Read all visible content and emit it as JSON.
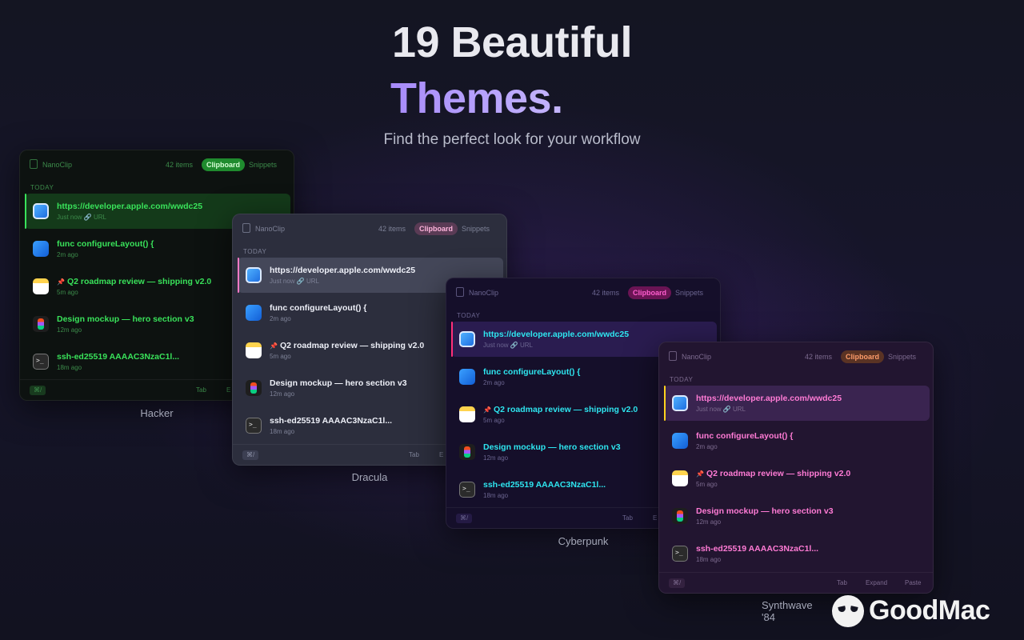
{
  "hero": {
    "title_line1": "19 Beautiful",
    "title_line2": "Themes.",
    "subtitle": "Find the perfect look for your workflow"
  },
  "panel": {
    "app_name": "NanoClip",
    "item_count": "42 items",
    "tab_clipboard": "Clipboard",
    "tab_snippets": "Snippets",
    "section": "TODAY",
    "footer_key": "⌘/",
    "hint_tab": "Tab",
    "hint_expand": "Expand",
    "hint_paste": "Paste",
    "hint_expand_short": "E"
  },
  "items": [
    {
      "title": "https://developer.apple.com/wwdc25",
      "meta": "Just now  🔗 URL",
      "icon": "safari-icon"
    },
    {
      "title": "func configureLayout() {",
      "meta": "2m ago",
      "icon": "xcode-icon"
    },
    {
      "title": "Q2 roadmap review — shipping v2.0",
      "meta": "5m ago",
      "icon": "notes-icon",
      "pin": "📌"
    },
    {
      "title": "Design mockup — hero section v3",
      "meta": "12m ago",
      "icon": "figma-icon"
    },
    {
      "title": "ssh-ed25519 AAAAC3NzaC1l...",
      "meta": "18m ago",
      "icon": "terminal-icon"
    }
  ],
  "themes": [
    "Hacker",
    "Dracula",
    "Cyberpunk",
    "Synthwave '84"
  ],
  "brand": {
    "logo_text": "GoodMac"
  },
  "colors": {
    "hacker_accent": "#39e25a",
    "dracula_accent": "#ff79c6",
    "cyberpunk_accent": "#2ee6f0",
    "synthwave_accent": "#ff7bd5",
    "title_accent": "#a78bfa"
  }
}
